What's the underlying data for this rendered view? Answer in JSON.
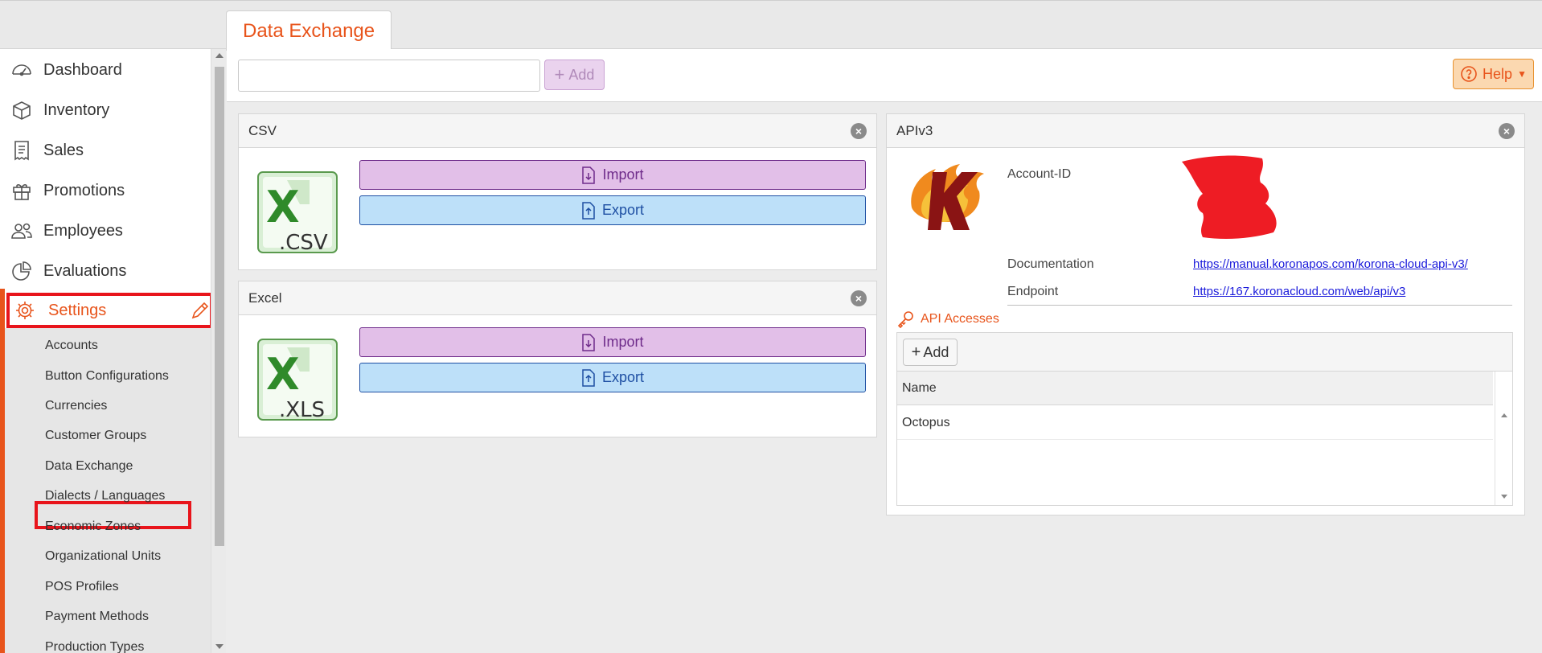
{
  "tab": {
    "title": "Data Exchange"
  },
  "sidebar": {
    "main_items": [
      {
        "label": "Dashboard",
        "icon": "dashboard-icon"
      },
      {
        "label": "Inventory",
        "icon": "box-icon"
      },
      {
        "label": "Sales",
        "icon": "receipt-icon"
      },
      {
        "label": "Promotions",
        "icon": "gift-icon"
      },
      {
        "label": "Employees",
        "icon": "users-icon"
      },
      {
        "label": "Evaluations",
        "icon": "pie-chart-icon"
      }
    ],
    "settings": {
      "label": "Settings",
      "icon": "gear-icon"
    },
    "sub_items": [
      "Accounts",
      "Button Configurations",
      "Currencies",
      "Customer Groups",
      "Data Exchange",
      "Dialects / Languages",
      "Economic Zones",
      "Organizational Units",
      "POS Profiles",
      "Payment Methods",
      "Production Types"
    ]
  },
  "toolbar": {
    "search_value": "",
    "add_label": "Add",
    "help_label": "Help"
  },
  "csv_panel": {
    "title": "CSV",
    "import_label": "Import",
    "export_label": "Export",
    "file_ext": ".CSV"
  },
  "excel_panel": {
    "title": "Excel",
    "import_label": "Import",
    "export_label": "Export",
    "file_ext": ".XLS"
  },
  "api_panel": {
    "title": "APIv3",
    "account_id_label": "Account-ID",
    "documentation_label": "Documentation",
    "documentation_url": "https://manual.koronapos.com/korona-cloud-api-v3/",
    "endpoint_label": "Endpoint",
    "endpoint_url": "https://167.koronacloud.com/web/api/v3",
    "accesses_title": "API Accesses",
    "add_label": "Add",
    "column_name": "Name",
    "rows": [
      "Octopus"
    ]
  },
  "colors": {
    "accent": "#e8541b",
    "import_bg": "#e2bfe8",
    "export_bg": "#bde0f9",
    "highlight": "#e8141b"
  }
}
